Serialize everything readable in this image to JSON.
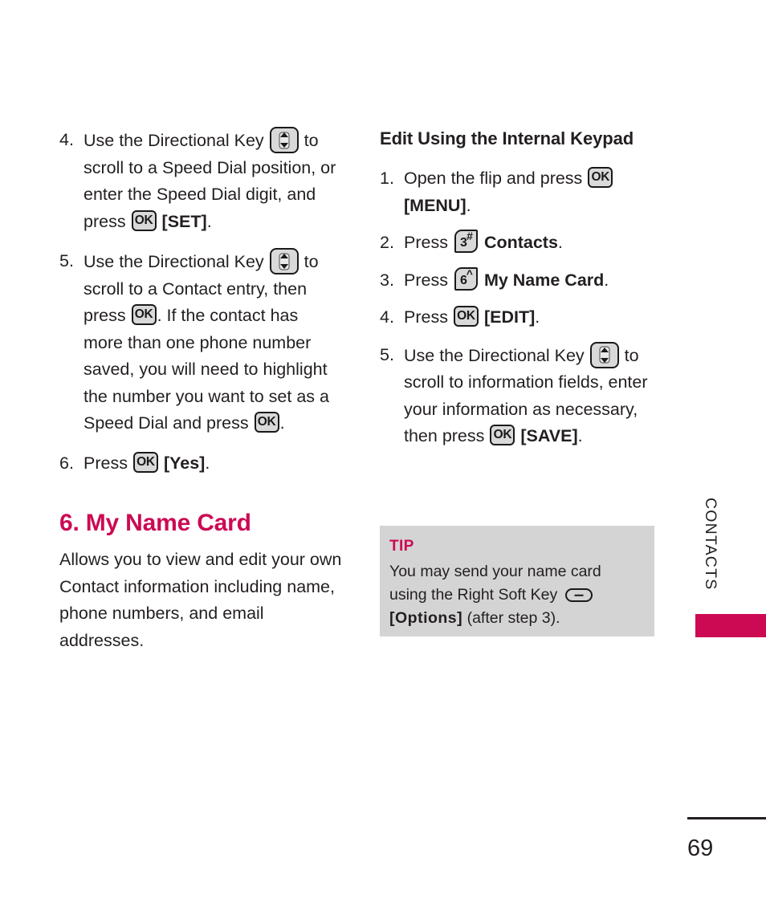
{
  "page": {
    "number": "69",
    "side_tab_label": "CONTACTS",
    "accent_color": "#cc0a53",
    "tip_bg_color": "#d4d4d4"
  },
  "left_column": {
    "steps": [
      {
        "num": "4.",
        "part1": "Use the Directional Key",
        "key1": "directional-key",
        "part2": "to scroll to a Speed Dial position, or enter the Speed Dial digit, and press",
        "key2": "ok-key",
        "part3": "",
        "bracket": "[SET]",
        "part4": "."
      },
      {
        "num": "5.",
        "part1": "Use the Directional Key",
        "key1": "directional-key",
        "part2": "to scroll to a Contact entry, then press",
        "key2": "ok-key",
        "part3": ". If the contact has more than one phone number saved, you will need to highlight the number you want to set as a Speed Dial and press",
        "key3": "ok-key",
        "part4": "."
      },
      {
        "num": "6.",
        "part1": "Press",
        "key1": "ok-key",
        "bracket": "[Yes]",
        "part4": "."
      }
    ],
    "section_heading": "6. My Name Card",
    "section_body": "Allows you to view and edit your own Contact information including name, phone numbers, and email addresses."
  },
  "right_column": {
    "sub_heading": "Edit Using the Internal Keypad",
    "steps": [
      {
        "num": "1.",
        "part1": "Open the flip and press",
        "key": "ok-key",
        "bracket": "[MENU]",
        "part2": "."
      },
      {
        "num": "2.",
        "part1": "Press",
        "key": "keypad-3",
        "key_digit": "3",
        "key_superscript": "#",
        "bold_text": "Contacts",
        "part2": "."
      },
      {
        "num": "3.",
        "part1": "Press",
        "key": "keypad-6",
        "key_digit": "6",
        "key_superscript": "^",
        "bold_text": "My Name Card",
        "part2": "."
      },
      {
        "num": "4.",
        "part1": "Press",
        "key": "ok-key",
        "bracket": "[EDIT]",
        "part2": "."
      },
      {
        "num": "5.",
        "part1": "Use the Directional Key",
        "key": "directional-key",
        "part2": "to scroll to information fields, enter your information as necessary, then press",
        "key2": "ok-key",
        "bracket": "[SAVE]",
        "part3": "."
      }
    ]
  },
  "tip": {
    "title": "TIP",
    "body_part1": "You may send your name card using the Right Soft Key",
    "soft_key": "right-soft-key",
    "options_label": "[Options]",
    "body_part2": "(after step 3)."
  }
}
